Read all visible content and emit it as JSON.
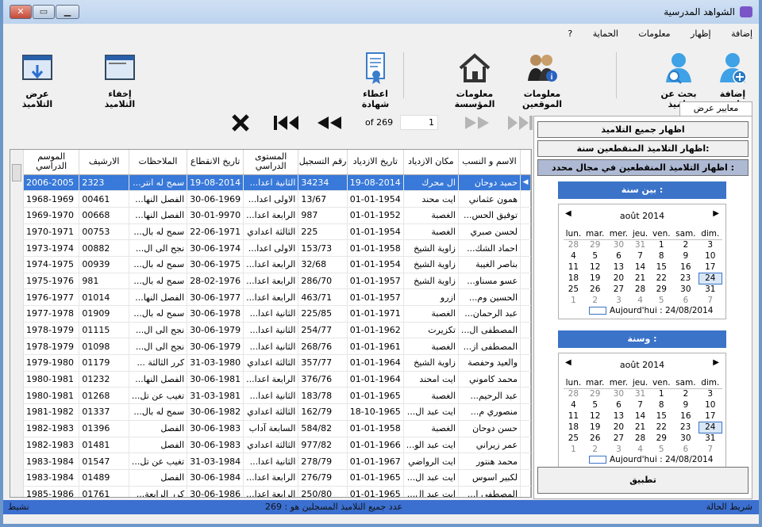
{
  "window": {
    "title": "الشواهد المدرسية"
  },
  "menu": [
    "إضافة",
    "إظهار",
    "معلومات",
    "الحماية",
    "?"
  ],
  "toolbar": {
    "add_student": "إضافة تلميذ",
    "search_student": "بحث عن تلميذ",
    "employees_info": "معلومات الموقعين",
    "institution_info": "معلومات المؤسسة",
    "give_certificate": "اعطاء شهادة",
    "hide_students": "إخفاء التلاميذ",
    "show_students": "عرض التلاميذ"
  },
  "pager": {
    "of_text": "of 269",
    "current": "1"
  },
  "panel": {
    "tab_label": "معايير عرض التلاميذ",
    "btn_all": "اظهار جميع التلاميذ",
    "btn_year": "اظهار التلاميذ المنقطعين سنة:",
    "btn_range": "اظهار التلاميذ المنقطعين في مجال محدد :",
    "between_label": "بين سنة :",
    "and_label": "وسنة :",
    "apply_label": "تطبيق",
    "calendar": {
      "month": "août 2014",
      "days": [
        "lun.",
        "mar.",
        "mer.",
        "jeu.",
        "ven.",
        "sam.",
        "dim."
      ],
      "weeks": [
        [
          "28",
          "29",
          "30",
          "31",
          "1",
          "2",
          "3"
        ],
        [
          "4",
          "5",
          "6",
          "7",
          "8",
          "9",
          "10"
        ],
        [
          "11",
          "12",
          "13",
          "14",
          "15",
          "16",
          "17"
        ],
        [
          "18",
          "19",
          "20",
          "21",
          "22",
          "23",
          "24"
        ],
        [
          "25",
          "26",
          "27",
          "28",
          "29",
          "30",
          "31"
        ],
        [
          "1",
          "2",
          "3",
          "4",
          "5",
          "6",
          "7"
        ]
      ],
      "today_text": "Aujourd'hui : 24/08/2014"
    }
  },
  "grid": {
    "columns": [
      "الاسم و النسب",
      "مكان الازدياد",
      "تاريخ الازدياد",
      "رقم التسجيل",
      "المستوى الدراسي",
      "تاريخ الانقطاع",
      "الملاحظات",
      "الارشيف",
      "الموسم الدراسي"
    ],
    "rows": [
      [
        "حميد دوحان",
        "ال محرك",
        "19-08-2014",
        "34234",
        "الثانية اعدا...",
        "19-08-2014",
        "سمح له انتر...",
        "2323",
        "2006-2005"
      ],
      [
        "همون عثماني",
        "ايت محند",
        "01-01-1954",
        "13/67",
        "الاولى اعدا...",
        "30-06-1969",
        "الفصل النها...",
        "00461",
        "1968-1969"
      ],
      [
        "توفيق الحس...",
        "الغصبة",
        "01-01-1952",
        "987",
        "الرابعة اعدا...",
        "30-01-9970",
        "الفصل النها...",
        "00668",
        "1969-1970"
      ],
      [
        "لحسن صبري",
        "الغصبة",
        "01-01-1954",
        "225",
        "الثالثة اعدادي",
        "22-06-1971",
        "سمح له بال...",
        "00753",
        "1970-1971"
      ],
      [
        "احماد الشك...",
        "زاوية الشيخ",
        "01-01-1958",
        "153/73",
        "الاولى اعدا...",
        "30-06-1974",
        "نجح الى ال...",
        "00882",
        "1973-1974"
      ],
      [
        "بناصر الغيبة",
        "زاوية الشيخ",
        "01-01-1954",
        "32/68",
        "الرابعة اعدا...",
        "30-06-1975",
        "سمح له بال...",
        "00939",
        "1974-1975"
      ],
      [
        "عسو مسناو...",
        "زاوية الشيخ",
        "01-01-1957",
        "286/70",
        "الرابعة اعدا...",
        "28-02-1976",
        "سمح له بال...",
        "981",
        "1975-1976"
      ],
      [
        "الحسين وم...",
        "ازرو",
        "01-01-1957",
        "463/71",
        "الرابعة اعدا...",
        "30-06-1977",
        "الفصل النها...",
        "01014",
        "1976-1977"
      ],
      [
        "عبد الرحمان...",
        "الغصبة",
        "01-01-1971",
        "225/85",
        "الثانية اعدا...",
        "30-06-1978",
        "سمح له بال...",
        "01909",
        "1977-1978"
      ],
      [
        "المصطفى ال...",
        "تكزيرت",
        "01-01-1962",
        "254/77",
        "الثانية اعدا...",
        "30-06-1979",
        "نجح الى ال...",
        "01115",
        "1978-1979"
      ],
      [
        "المصطفى از...",
        "الغصبة",
        "01-01-1961",
        "268/76",
        "الثانية اعدا...",
        "30-06-1979",
        "نجح الى ال...",
        "01098",
        "1978-1979"
      ],
      [
        "والعيد وحفصة",
        "زاوية الشيخ",
        "01-01-1964",
        "357/77",
        "الثالثة اعدادي",
        "31-03-1980",
        "كرر الثالثة ...",
        "01179",
        "1979-1980"
      ],
      [
        "محمد كاموني",
        "ايت امحند",
        "01-01-1964",
        "376/76",
        "الرابعة اعدا...",
        "30-06-1981",
        "الفصل النها...",
        "01232",
        "1980-1981"
      ],
      [
        "عبد الرحيم...",
        "الغصبة",
        "01-01-1965",
        "183/78",
        "الثانية اعدا...",
        "31-03-1981",
        "تغيب عن تل...",
        "01268",
        "1980-1981"
      ],
      [
        "منصوري م...",
        "ايت عبد ال...",
        "18-10-1965",
        "162/79",
        "الثالثة اعدادي",
        "30-06-1982",
        "سمح له بال...",
        "01337",
        "1981-1982"
      ],
      [
        "حسن دوحان",
        "الغصبة",
        "01-01-1958",
        "584/82",
        "السابعة آداب",
        "30-06-1983",
        "الفصل",
        "01396",
        "1982-1983"
      ],
      [
        "عمر زيراني",
        "ايت عبد الو...",
        "01-01-1966",
        "977/82",
        "الثالثة اعدادي",
        "30-06-1983",
        "الفصل",
        "01481",
        "1982-1983"
      ],
      [
        "محمد هنتور",
        "ايت الرواضي",
        "01-01-1967",
        "278/79",
        "الثانية اعدا...",
        "31-03-1984",
        "تغيب عن تل...",
        "01547",
        "1983-1984"
      ],
      [
        "لكبير اسوس",
        "ايت عبد ال...",
        "01-01-1965",
        "276/79",
        "الرابعة اعدا...",
        "30-06-1984",
        "الفصل",
        "01489",
        "1983-1984"
      ],
      [
        "المصطفى ا...",
        "ايت عبد ال...",
        "01-01-1965",
        "250/80",
        "الرابعة اعدا...",
        "30-06-1986",
        "كرر الرابعة...",
        "01761",
        "1985-1986"
      ]
    ]
  },
  "status": {
    "left": "نشيط",
    "center": "عدد جميع التلاميذ المسجلين  هو : 269",
    "right": "شريط الحالة"
  }
}
